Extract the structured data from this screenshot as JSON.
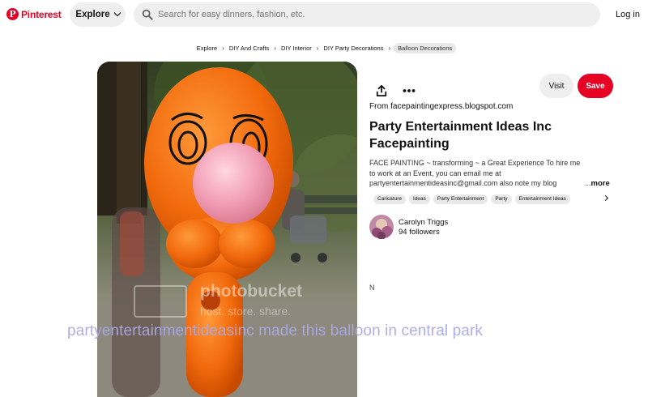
{
  "header": {
    "logo_text": "Pinterest",
    "explore_label": "Explore",
    "search_placeholder": "Search for easy dinners, fashion, etc.",
    "login_label": "Log in"
  },
  "breadcrumbs": [
    "Explore",
    "DIY And Crafts",
    "DIY Interior",
    "DIY Party Decorations",
    "Balloon Decorations"
  ],
  "pin": {
    "watermark_brand": "photobucket",
    "watermark_sub": "host. store. share.",
    "caption_overlay": "partyentertainmentideasinc made this balloon in central park"
  },
  "actions": {
    "visit_label": "Visit",
    "save_label": "Save"
  },
  "details": {
    "source_prefix": "From ",
    "source_domain": "facepaintingexpress.blogspot.com",
    "title": "Party Entertainment Ideas Inc Facepainting",
    "description_lines": [
      "FACE PAINTING ~ transforming ~ a Great Experience To hire me",
      "to work at an Event, you can email me at",
      "partyentertainmentideasinc@gmail.com also note my blog"
    ],
    "description_ellipsis": "...",
    "more_label": "more",
    "tags": [
      "Caricature",
      "Ideas",
      "Party Entertainment",
      "Party",
      "Entertainment Ideas"
    ],
    "stray_char": "N"
  },
  "creator": {
    "name": "Carolyn Triggs",
    "followers": "94 followers"
  },
  "colors": {
    "brand": "#e60023",
    "chip_bg": "#efefef",
    "balloon_orange": "#f26a0c",
    "balloon_pink": "#f3a1b8"
  },
  "icons": [
    "pinterest-logo-icon",
    "chevron-down-icon",
    "search-icon",
    "share-icon",
    "more-icon",
    "chevron-right-icon"
  ]
}
